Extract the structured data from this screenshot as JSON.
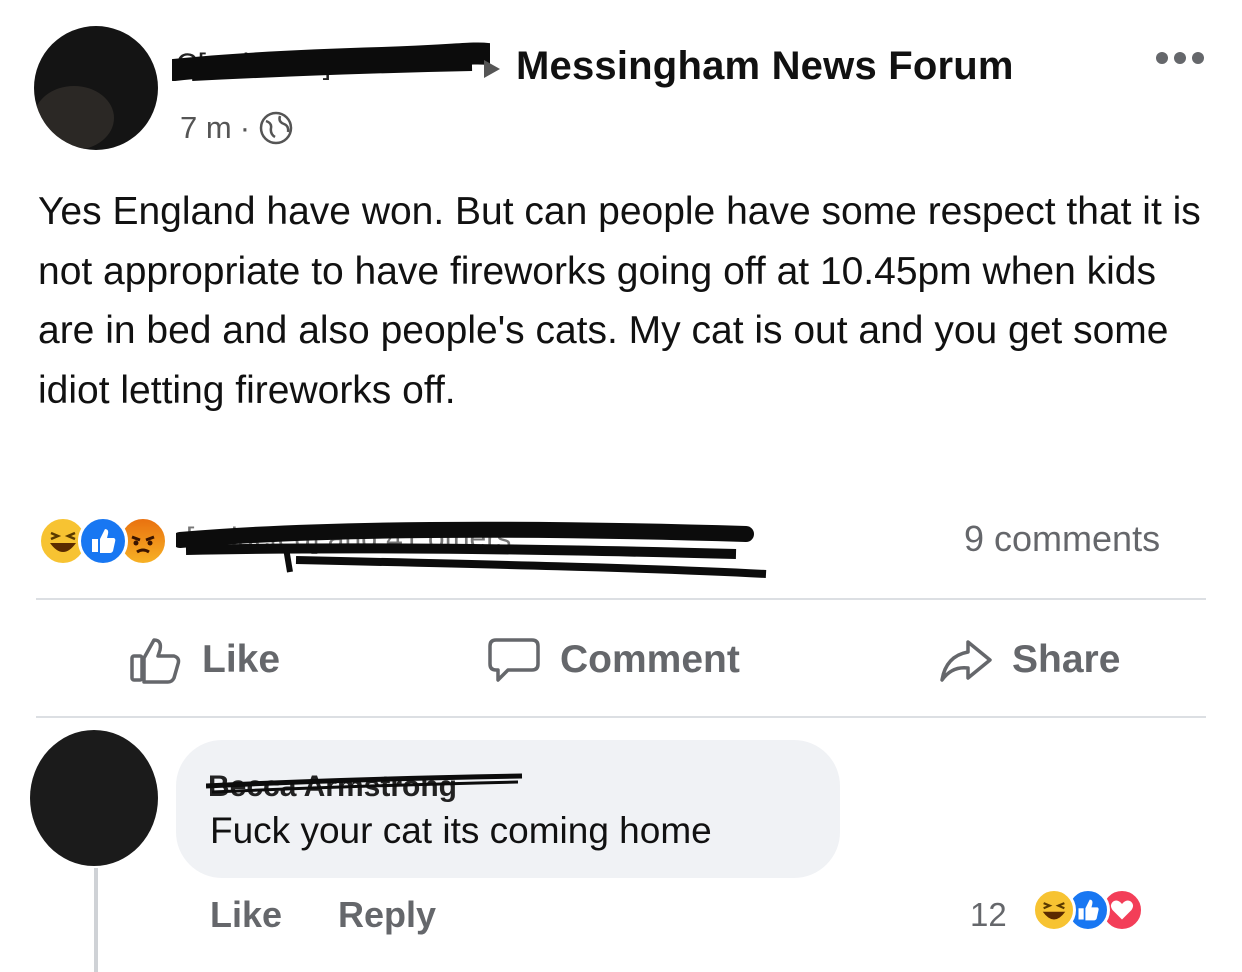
{
  "post": {
    "author_name": "C[redacted]",
    "group_name": "Messingham News Forum",
    "timestamp": "7 m",
    "separator": "·",
    "privacy_icon": "globe-icon",
    "more_icon": "more-options-icon",
    "text": "Yes England have won. But can people have some respect that it is not appropriate to have fireworks going off at 10.45pm when kids are in bed and also people's cats. My cat is out and you get some idiot letting fireworks off.",
    "reactions": [
      "haha",
      "like",
      "angry"
    ],
    "reaction_names": "[redacted] and 41 others",
    "comments_count": "9 comments"
  },
  "actions": {
    "like": "Like",
    "comment": "Comment",
    "share": "Share"
  },
  "comment": {
    "author_name": "Becca Armstrong",
    "text": "Fuck your cat its coming home",
    "like_label": "Like",
    "reply_label": "Reply",
    "reaction_count": "12",
    "reactions": [
      "haha",
      "like",
      "love"
    ]
  },
  "colors": {
    "like_blue": "#1877f2",
    "haha_yellow": "#f7c332",
    "angry_orange": "#e9710f",
    "love_red": "#f33e58",
    "secondary_text": "#65676b",
    "bubble_bg": "#f0f2f5"
  }
}
